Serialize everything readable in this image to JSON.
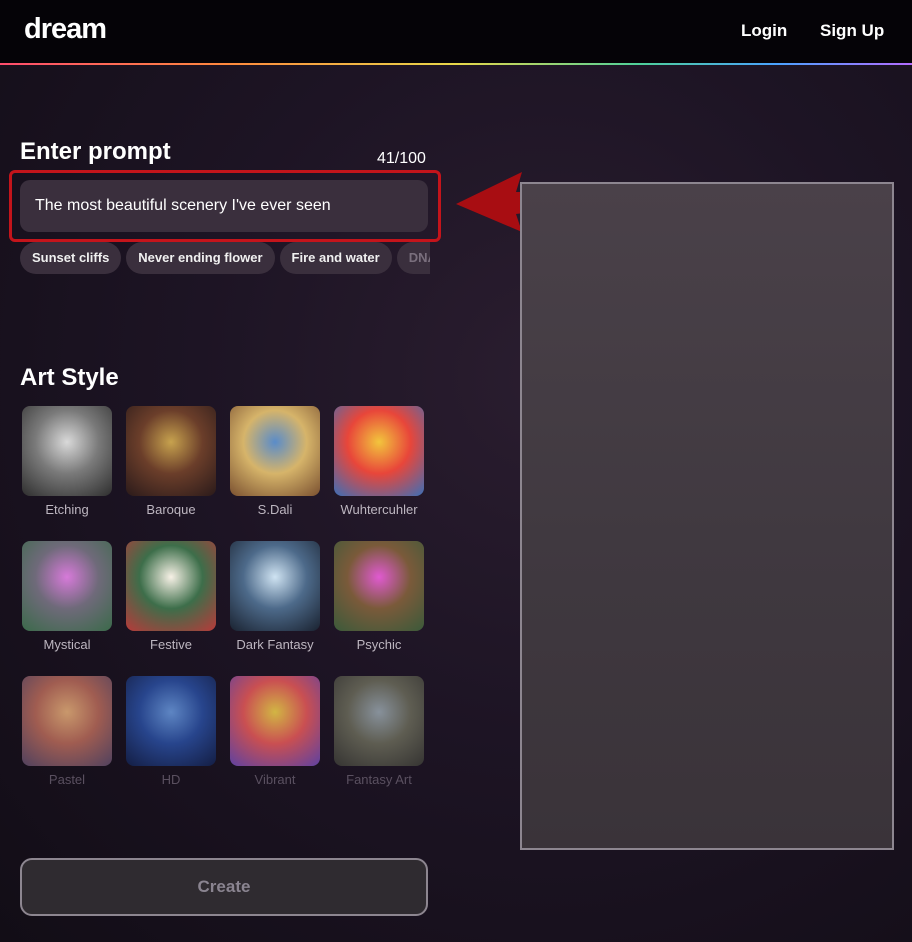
{
  "header": {
    "logo": "dream",
    "login": "Login",
    "signup": "Sign Up"
  },
  "prompt": {
    "title": "Enter prompt",
    "counter": "41/100",
    "value": "The most beautiful scenery I've ever seen",
    "suggestions": [
      "Sunset cliffs",
      "Never ending flower",
      "Fire and water",
      "DNA tor"
    ]
  },
  "art_style": {
    "title": "Art Style",
    "styles": [
      {
        "label": "Etching",
        "colors": [
          "#d9d9d9",
          "#7a7a7a",
          "#2e2e2e"
        ]
      },
      {
        "label": "Baroque",
        "colors": [
          "#c7a24e",
          "#6b3e2a",
          "#2a1a1a"
        ]
      },
      {
        "label": "S.Dali",
        "colors": [
          "#5a8cc9",
          "#d6b46a",
          "#7a5030"
        ]
      },
      {
        "label": "Wuhtercuhler",
        "colors": [
          "#f2c53d",
          "#e8463a",
          "#3b6fb8"
        ]
      },
      {
        "label": "Mystical",
        "colors": [
          "#d67ad9",
          "#6f6a7a",
          "#3b6a4a"
        ]
      },
      {
        "label": "Festive",
        "colors": [
          "#f7f1e6",
          "#3d6e4a",
          "#b83a3a"
        ]
      },
      {
        "label": "Dark Fantasy",
        "colors": [
          "#cfe3f2",
          "#4d6a8a",
          "#1a2230"
        ]
      },
      {
        "label": "Psychic",
        "colors": [
          "#e05ad0",
          "#7a5a3a",
          "#3b5a3a"
        ]
      },
      {
        "label": "Pastel",
        "colors": [
          "#e8b07a",
          "#b86a5a",
          "#5a4a6a"
        ]
      },
      {
        "label": "HD",
        "colors": [
          "#6a9ae0",
          "#2a4ea0",
          "#13204a"
        ]
      },
      {
        "label": "Vibrant",
        "colors": [
          "#f2d24a",
          "#e85a5a",
          "#6a4ab8"
        ]
      },
      {
        "label": "Fantasy Art",
        "colors": [
          "#9aa7b0",
          "#6a6a5a",
          "#3a3a35"
        ]
      }
    ]
  },
  "create_button": "Create",
  "colors": {
    "annotation": "#c4141b",
    "panel": "#3a2f3d"
  }
}
